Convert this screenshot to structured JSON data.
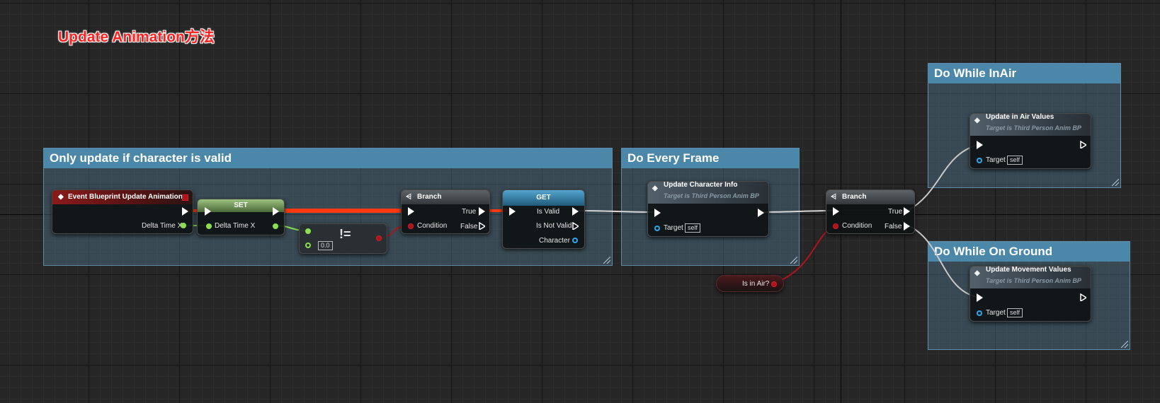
{
  "page_title": "Update Animation方法",
  "comments": {
    "valid": "Only update if character is valid",
    "frame": "Do Every Frame",
    "inair": "Do While InAir",
    "ground": "Do While On Ground"
  },
  "nodes": {
    "event": {
      "title": "Event Blueprint Update Animation",
      "pin_delta": "Delta Time X"
    },
    "set": {
      "title": "SET",
      "pin_delta": "Delta Time X"
    },
    "notequal": {
      "symbol": "!=",
      "value": "0.0"
    },
    "branch1": {
      "title": "Branch",
      "pin_condition": "Condition",
      "pin_true": "True",
      "pin_false": "False"
    },
    "get": {
      "title": "GET",
      "pin_valid": "Is Valid",
      "pin_notvalid": "Is Not Valid",
      "pin_character": "Character"
    },
    "update_char": {
      "title": "Update Character Info",
      "subtitle": "Target is Third Person Anim BP",
      "pin_target": "Target",
      "target_value": "self"
    },
    "branch2": {
      "title": "Branch",
      "pin_condition": "Condition",
      "pin_true": "True",
      "pin_false": "False"
    },
    "isinair": {
      "label": "Is in Air?"
    },
    "update_air": {
      "title": "Update in Air Values",
      "subtitle": "Target is Third Person Anim BP",
      "pin_target": "Target",
      "target_value": "self"
    },
    "update_move": {
      "title": "Update Movement Values",
      "subtitle": "Target is Third Person Anim BP",
      "pin_target": "Target",
      "target_value": "self"
    }
  },
  "colors": {
    "exec_wire_active": "#ff3a10",
    "exec_wire": "#d8d8d8",
    "float_pin": "#8be04e",
    "bool_pin": "#b0141a",
    "object_pin": "#2aa8f0",
    "comment_header": "#4b87a8"
  }
}
